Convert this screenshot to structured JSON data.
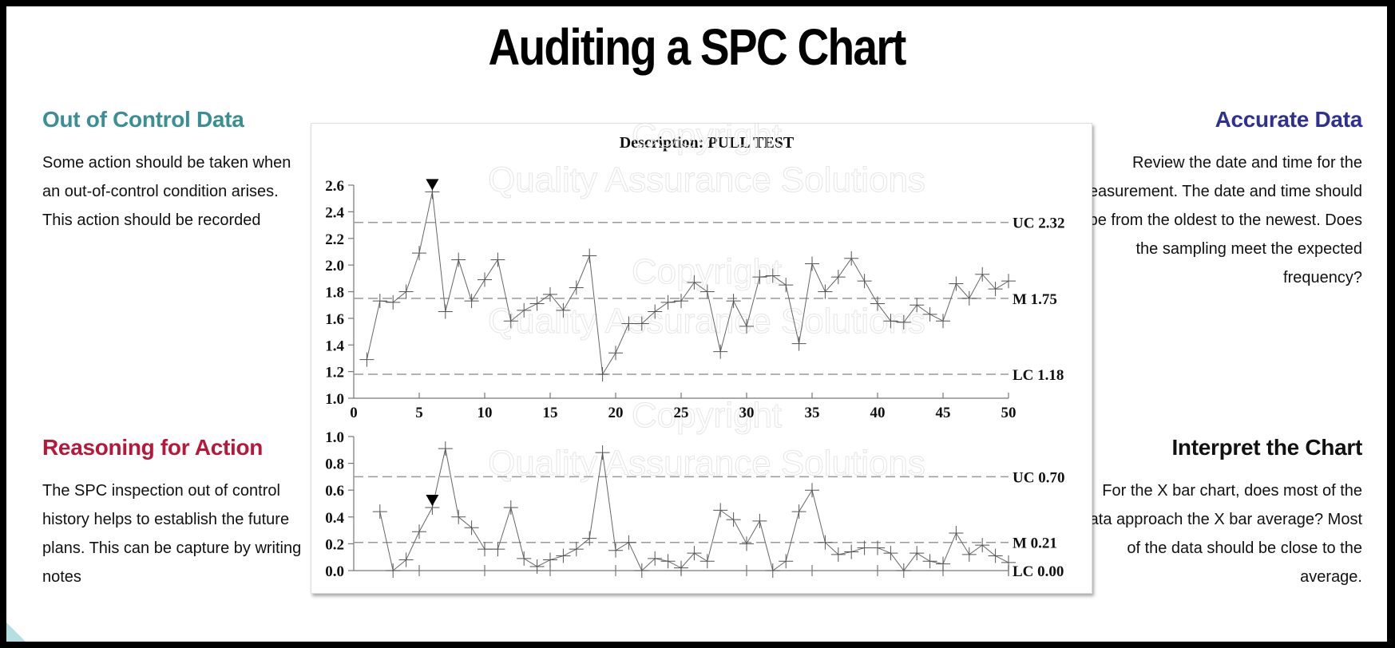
{
  "slide": {
    "title": "Auditing a SPC Chart",
    "blocks": {
      "out_of_control": {
        "heading": "Out of Control Data",
        "heading_color": "#3a8f94",
        "body": "Some action should be taken when an out-of-control condition arises. This action should be recorded"
      },
      "reasoning": {
        "heading": "Reasoning for Action",
        "heading_color": "#b8173a",
        "body": "The SPC inspection out of control history helps to establish the future plans. This can be capture by writing notes"
      },
      "accurate": {
        "heading": "Accurate Data",
        "heading_color": "#2e3192",
        "body": "Review the date and time for the measurement. The date and time should be from the oldest to the newest. Does the sampling meet the expected frequency?"
      },
      "interpret": {
        "heading": "Interpret the Chart",
        "heading_color": "#111111",
        "body": "For the X bar chart, does most of the data approach the X bar average? Most of the data should be close to the average."
      }
    },
    "watermark": [
      "Copyright",
      "Quality Assurance Solutions"
    ]
  },
  "chart_data": [
    {
      "type": "line",
      "title": "Description: PULL TEST",
      "xlabel": "",
      "ylabel": "",
      "xlim": [
        0,
        50
      ],
      "ylim": [
        1.0,
        2.6
      ],
      "xticks": [
        0,
        5,
        10,
        15,
        20,
        25,
        30,
        35,
        40,
        45,
        50
      ],
      "yticks": [
        "1.0",
        "1.2",
        "1.4",
        "1.6",
        "1.8",
        "2.0",
        "2.2",
        "2.4",
        "2.6"
      ],
      "grid": false,
      "marker": "plus",
      "control_lines": [
        {
          "name": "UC",
          "label": "UC 2.32",
          "value": 2.32
        },
        {
          "name": "M",
          "label": "M 1.75",
          "value": 1.75
        },
        {
          "name": "LC",
          "label": "LC 1.18",
          "value": 1.18
        }
      ],
      "flagged_points": [
        6
      ],
      "x": [
        1,
        2,
        3,
        4,
        5,
        6,
        7,
        8,
        9,
        10,
        11,
        12,
        13,
        14,
        15,
        16,
        17,
        18,
        19,
        20,
        21,
        22,
        23,
        24,
        25,
        26,
        27,
        28,
        29,
        30,
        31,
        32,
        33,
        34,
        35,
        36,
        37,
        38,
        39,
        40,
        41,
        42,
        43,
        44,
        45,
        46,
        47,
        48,
        49,
        50
      ],
      "values": [
        1.29,
        1.73,
        1.72,
        1.8,
        2.09,
        2.55,
        1.65,
        2.04,
        1.73,
        1.89,
        2.04,
        1.58,
        1.66,
        1.71,
        1.78,
        1.66,
        1.83,
        2.07,
        1.18,
        1.34,
        1.56,
        1.56,
        1.65,
        1.72,
        1.73,
        1.87,
        1.8,
        1.35,
        1.73,
        1.54,
        1.91,
        1.92,
        1.85,
        1.41,
        2.01,
        1.8,
        1.91,
        2.05,
        1.88,
        1.71,
        1.58,
        1.57,
        1.7,
        1.63,
        1.58,
        1.86,
        1.75,
        1.93,
        1.82,
        1.88
      ]
    },
    {
      "type": "line",
      "title": "",
      "xlim": [
        0,
        50
      ],
      "ylim": [
        0.0,
        1.0
      ],
      "yticks": [
        "0.0",
        "0.2",
        "0.4",
        "0.6",
        "0.8",
        "1.0"
      ],
      "grid": false,
      "marker": "plus",
      "control_lines": [
        {
          "name": "UC",
          "label": "UC 0.70",
          "value": 0.7
        },
        {
          "name": "M",
          "label": "M 0.21",
          "value": 0.21
        },
        {
          "name": "LC",
          "label": "LC 0.00",
          "value": 0.0
        }
      ],
      "flagged_points": [
        6
      ],
      "x": [
        2,
        3,
        4,
        5,
        6,
        7,
        8,
        9,
        10,
        11,
        12,
        13,
        14,
        15,
        16,
        17,
        18,
        19,
        20,
        21,
        22,
        23,
        24,
        25,
        26,
        27,
        28,
        29,
        30,
        31,
        32,
        33,
        34,
        35,
        36,
        37,
        38,
        39,
        40,
        41,
        42,
        43,
        44,
        45,
        46,
        47,
        48,
        49,
        50
      ],
      "values": [
        0.44,
        0.0,
        0.08,
        0.29,
        0.47,
        0.91,
        0.4,
        0.32,
        0.16,
        0.16,
        0.47,
        0.09,
        0.03,
        0.08,
        0.11,
        0.16,
        0.24,
        0.88,
        0.15,
        0.21,
        0.0,
        0.09,
        0.07,
        0.02,
        0.13,
        0.07,
        0.45,
        0.38,
        0.2,
        0.37,
        0.0,
        0.07,
        0.44,
        0.6,
        0.21,
        0.12,
        0.14,
        0.17,
        0.17,
        0.13,
        0.0,
        0.13,
        0.07,
        0.05,
        0.28,
        0.12,
        0.19,
        0.11,
        0.06
      ]
    }
  ]
}
